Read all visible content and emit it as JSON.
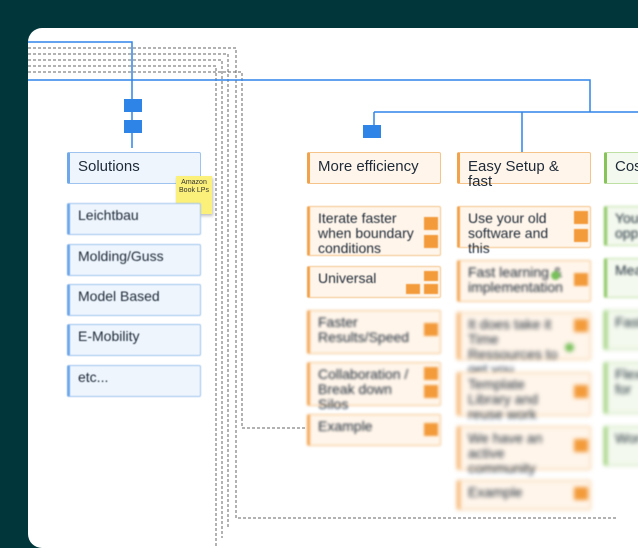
{
  "sticky_note": {
    "text": "Amazon Book LPs"
  },
  "columns": [
    {
      "header": "Solutions",
      "items": [
        "Leichtbau",
        "Molding/Guss",
        "Model Based",
        "E-Mobility",
        "etc..."
      ]
    },
    {
      "header": "More efficiency",
      "items": [
        "Iterate faster when boundary conditions",
        "Universal",
        "Faster Results/Speed",
        "Collaboration / Break down Silos",
        "Example"
      ]
    },
    {
      "header": "Easy Setup & fast",
      "items": [
        "Use your old software and this",
        "Fast learning & implementation",
        "It does take it Time Ressources to get you",
        "Template Library and reuse work",
        "We have an active community",
        "Example"
      ]
    },
    {
      "header": "Cos",
      "items": [
        "Your opp",
        "Mea",
        "Fast",
        "Flex for",
        "Wor"
      ]
    }
  ],
  "colors": {
    "background": "#01373b",
    "connector": "#2f84e8",
    "accent_orange": "#f39a3a",
    "accent_green": "#86c45a"
  }
}
